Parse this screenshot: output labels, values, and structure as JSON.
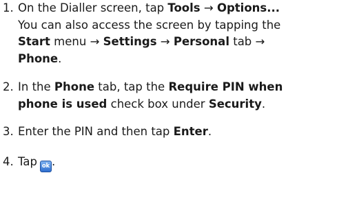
{
  "steps": [
    {
      "number": "1.",
      "lines": [
        [
          {
            "t": "On the Dialler screen, tap ",
            "b": false
          },
          {
            "t": "Tools",
            "b": true
          },
          {
            "t": " → ",
            "b": false
          },
          {
            "t": "Options...",
            "b": true
          }
        ],
        [
          {
            "t": "You can also access the screen by tapping the",
            "b": false
          }
        ],
        [
          {
            "t": "Start",
            "b": true
          },
          {
            "t": " menu → ",
            "b": false
          },
          {
            "t": "Settings",
            "b": true
          },
          {
            "t": " → ",
            "b": false
          },
          {
            "t": "Personal",
            "b": true
          },
          {
            "t": " tab →",
            "b": false
          }
        ],
        [
          {
            "t": "Phone",
            "b": true
          },
          {
            "t": ".",
            "b": false
          }
        ]
      ]
    },
    {
      "number": "2.",
      "lines": [
        [
          {
            "t": "In the ",
            "b": false
          },
          {
            "t": "Phone",
            "b": true
          },
          {
            "t": " tab, tap the ",
            "b": false
          },
          {
            "t": "Require PIN when",
            "b": true
          }
        ],
        [
          {
            "t": "phone is used",
            "b": true
          },
          {
            "t": " check box under ",
            "b": false
          },
          {
            "t": "Security",
            "b": true
          },
          {
            "t": ".",
            "b": false
          }
        ]
      ]
    },
    {
      "number": "3.",
      "lines": [
        [
          {
            "t": "Enter the PIN and then tap ",
            "b": false
          },
          {
            "t": "Enter",
            "b": true
          },
          {
            "t": ".",
            "b": false
          }
        ]
      ]
    },
    {
      "number": "4.",
      "lines": [
        [
          {
            "t": "Tap",
            "b": false
          },
          {
            "icon": "ok-icon",
            "label": "ok"
          },
          {
            "t": ".",
            "b": false
          }
        ]
      ]
    }
  ]
}
